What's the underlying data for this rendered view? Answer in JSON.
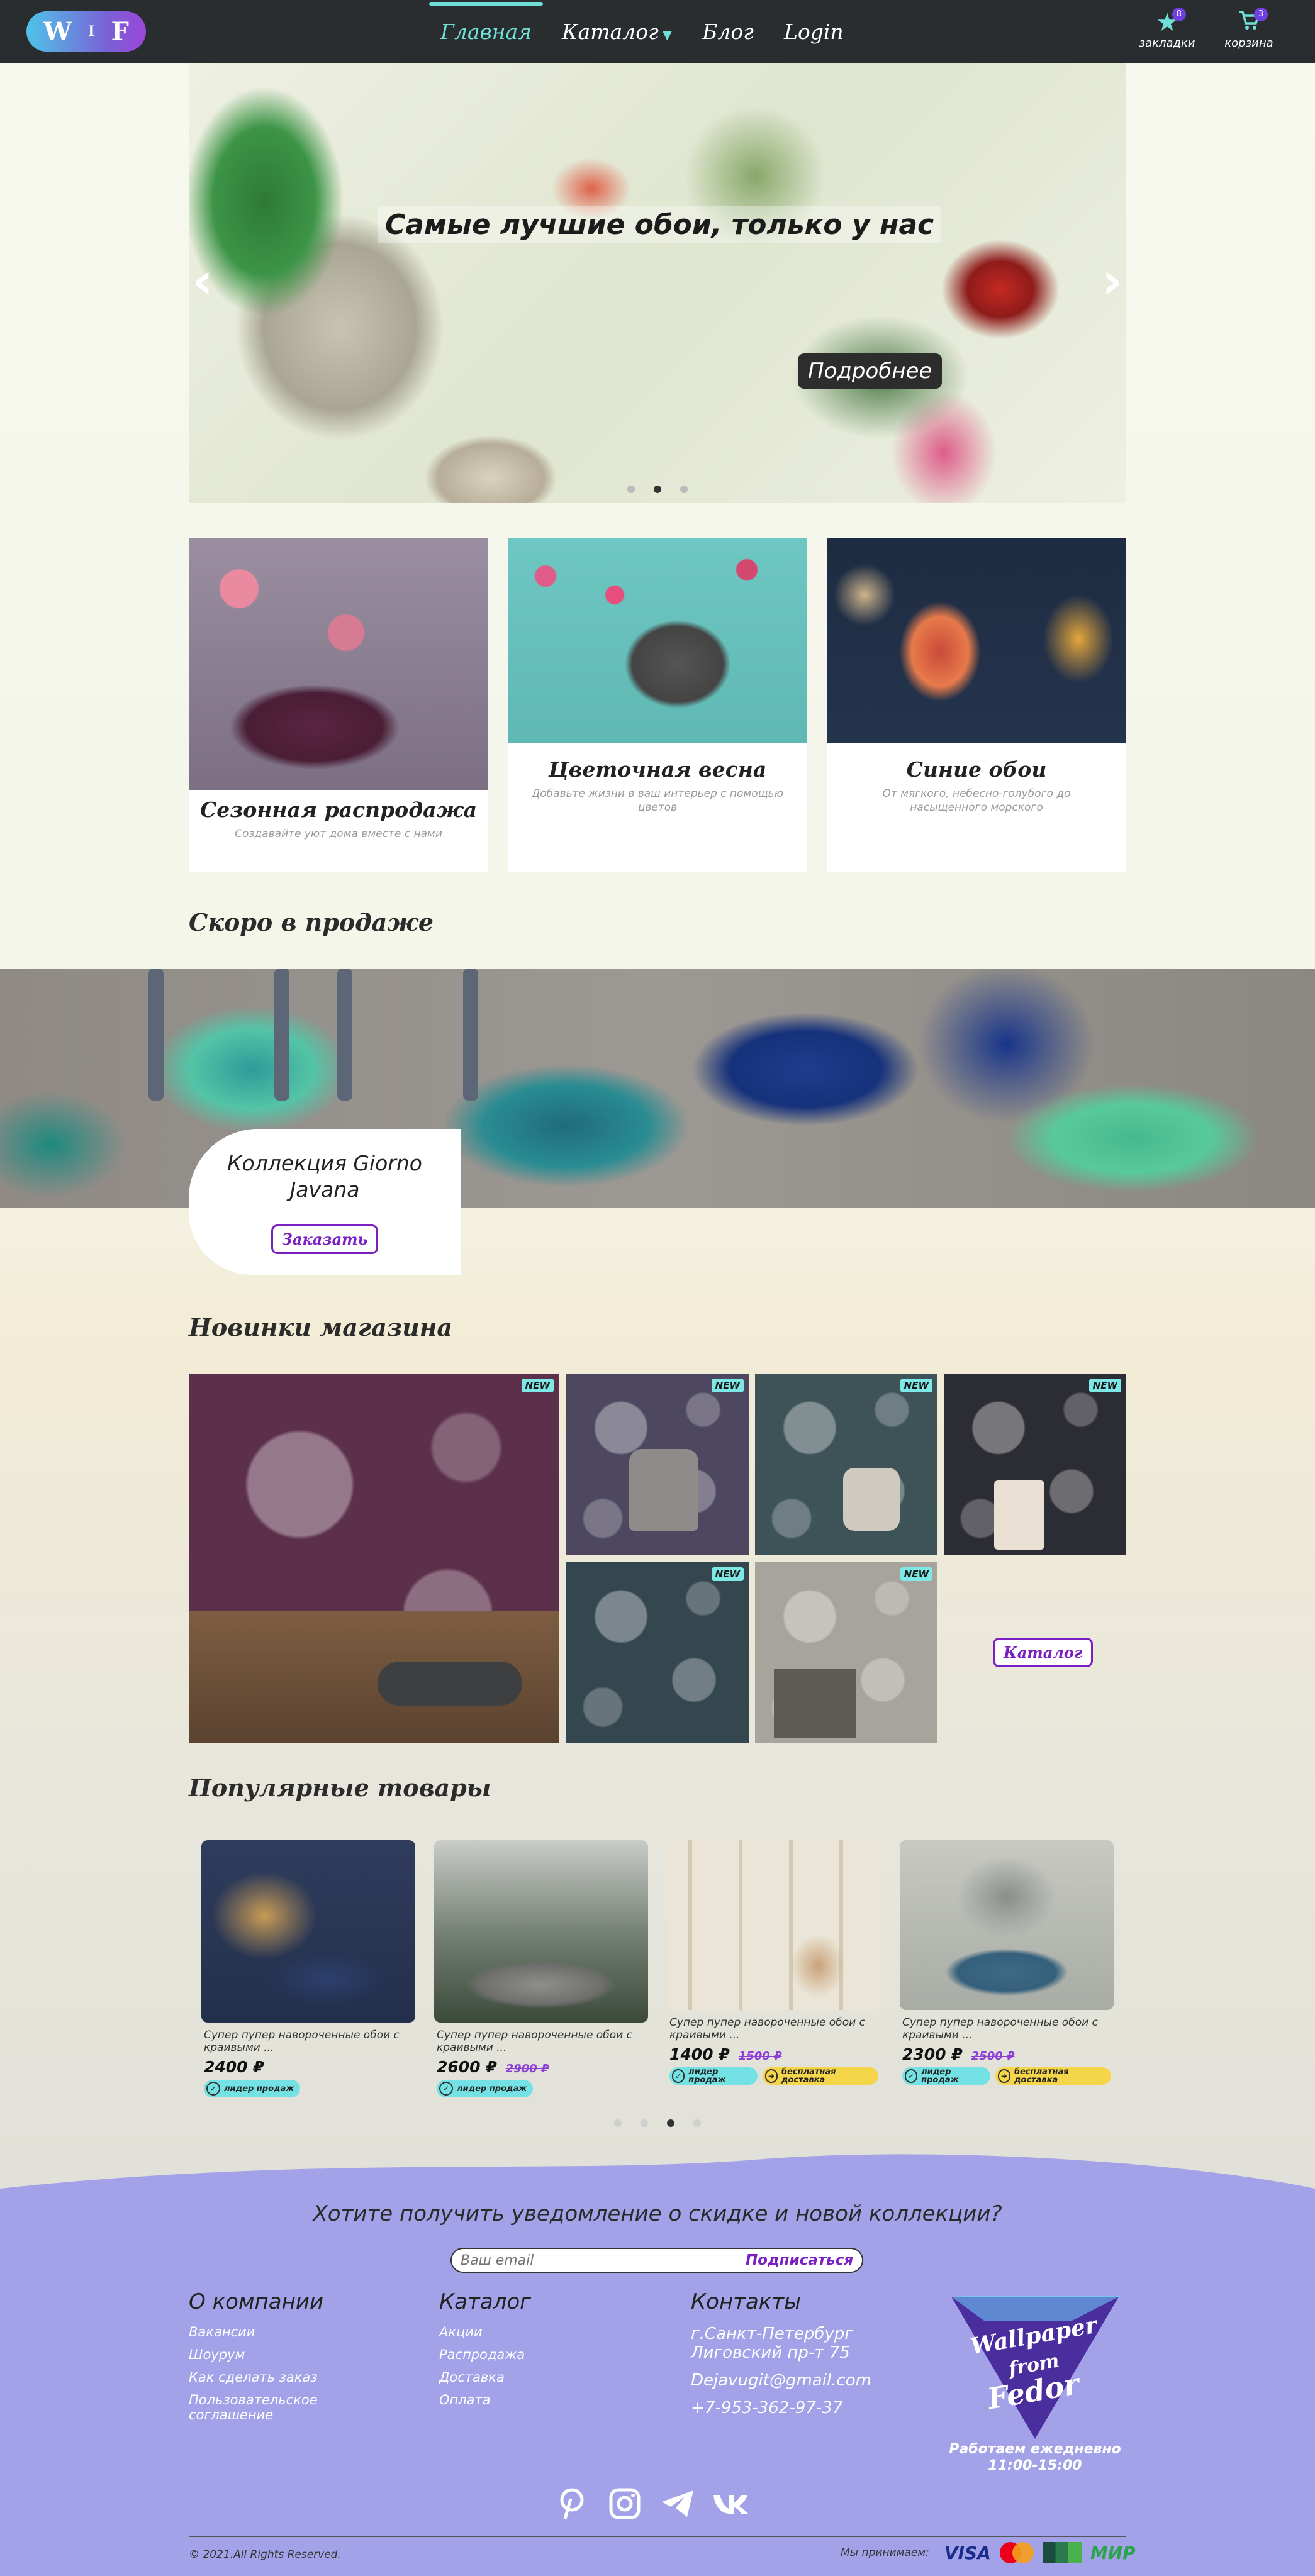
{
  "header": {
    "logo": {
      "left": "W",
      "mid": "I",
      "right": "F"
    },
    "nav": [
      {
        "label": "Главная",
        "active": true
      },
      {
        "label": "Каталог",
        "has_dropdown": true
      },
      {
        "label": "Блог"
      },
      {
        "label": "Login"
      }
    ],
    "bookmarks": {
      "label": "закладки",
      "count": "8",
      "icon": "star-icon"
    },
    "cart": {
      "label": "корзина",
      "count": "3",
      "icon": "cart-icon"
    }
  },
  "hero": {
    "title": "Самые лучшие обои, только у нас",
    "button": "Подробнее",
    "slides": 3,
    "active_slide": 2
  },
  "categories": [
    {
      "title": "Сезонная распродажа",
      "subtitle": "Создавайте уют дома вместе с нами"
    },
    {
      "title": "Цветочная весна",
      "subtitle": "Добавьте жизни в ваш интерьер с помощью цветов"
    },
    {
      "title": "Синие обои",
      "subtitle": "От мягкого, небесно-голубого до насыщенного морского"
    }
  ],
  "coming_soon": {
    "section_title": "Скоро в продаже",
    "collection": "Коллекция Giorno Javana",
    "button": "Заказать"
  },
  "new_products": {
    "section_title": "Новинки магазина",
    "badge": "NEW",
    "catalog_button": "Каталог"
  },
  "popular": {
    "section_title": "Популярные товары",
    "items": [
      {
        "desc": "Супер пупер навороченные обои с краивыми ...",
        "price": "2400 ₽",
        "old_price": "",
        "tags": [
          "лидер продаж"
        ]
      },
      {
        "desc": "Супер пупер навороченные обои с краивыми ...",
        "price": "2600 ₽",
        "old_price": "2900 ₽",
        "tags": [
          "лидер продаж"
        ]
      },
      {
        "desc": "Супер пупер навороченные обои с краивыми ...",
        "price": "1400 ₽",
        "old_price": "1500 ₽",
        "tags": [
          "лидер продаж",
          "бесплатная доставка"
        ]
      },
      {
        "desc": "Супер пупер навороченные обои с краивыми ...",
        "price": "2300 ₽",
        "old_price": "2500 ₽",
        "tags": [
          "лидер продаж",
          "бесплатная доставка"
        ]
      }
    ],
    "pages": 4,
    "active_page": 3
  },
  "footer": {
    "subscribe_title": "Хотите получить уведомление о скидке и новой коллекции?",
    "email_placeholder": "Ваш email",
    "subscribe_button": "Подписаться",
    "company": {
      "title": "О компании",
      "links": [
        "Вакансии",
        "Шоурум",
        "Как сделать заказ",
        "Пользовательское соглашение"
      ]
    },
    "catalog": {
      "title": "Каталог",
      "links": [
        "Акции",
        "Распродажа",
        "Доставка",
        "Оплата"
      ]
    },
    "contacts": {
      "title": "Контакты",
      "address": "г.Санкт-Петербург Лиговский пр-т 75",
      "email": "Dejavugit@gmail.com",
      "phone": "+7-953-362-97-37"
    },
    "brand": {
      "line1": "Wallpaper",
      "line2": "from",
      "line3": "Fedor"
    },
    "hours": "Работаем ежедневно 11:00-15:00",
    "social": [
      "pinterest-icon",
      "instagram-icon",
      "telegram-icon",
      "vk-icon"
    ],
    "copyright": "© 2021.All Rights Reserved.",
    "payments_label": "Мы принимаем:",
    "payments": [
      "VISA",
      "mastercard",
      "unistellar",
      "МИР"
    ]
  },
  "colors": {
    "header_bg": "#2a2d30",
    "accent": "#6fe0d8",
    "purple": "#7a1fc2",
    "footer_bg": "#a3a2e9"
  }
}
